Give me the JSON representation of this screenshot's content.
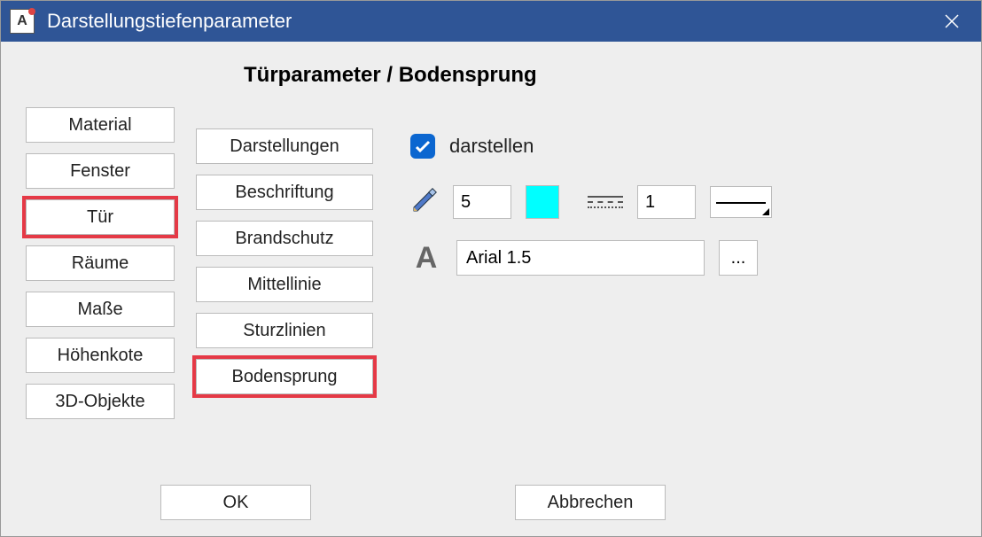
{
  "window": {
    "title": "Darstellungstiefenparameter",
    "app_icon_letter": "A"
  },
  "heading": "Türparameter / Bodensprung",
  "left_nav": [
    {
      "label": "Material",
      "highlighted": false
    },
    {
      "label": "Fenster",
      "highlighted": false
    },
    {
      "label": "Tür",
      "highlighted": true
    },
    {
      "label": "Räume",
      "highlighted": false
    },
    {
      "label": "Maße",
      "highlighted": false
    },
    {
      "label": "Höhenkote",
      "highlighted": false
    },
    {
      "label": "3D-Objekte",
      "highlighted": false
    }
  ],
  "mid_nav": [
    {
      "label": "Darstellungen",
      "highlighted": false
    },
    {
      "label": "Beschriftung",
      "highlighted": false
    },
    {
      "label": "Brandschutz",
      "highlighted": false
    },
    {
      "label": "Mittellinie",
      "highlighted": false
    },
    {
      "label": "Sturzlinien",
      "highlighted": false
    },
    {
      "label": "Bodensprung",
      "highlighted": true
    }
  ],
  "settings": {
    "show_checkbox": {
      "checked": true,
      "label": "darstellen"
    },
    "pen": {
      "number": "5",
      "color": "#00ffff"
    },
    "linetype": {
      "number": "1"
    },
    "font": {
      "value": "Arial 1.5",
      "browse": "..."
    }
  },
  "footer": {
    "ok": "OK",
    "cancel": "Abbrechen"
  }
}
